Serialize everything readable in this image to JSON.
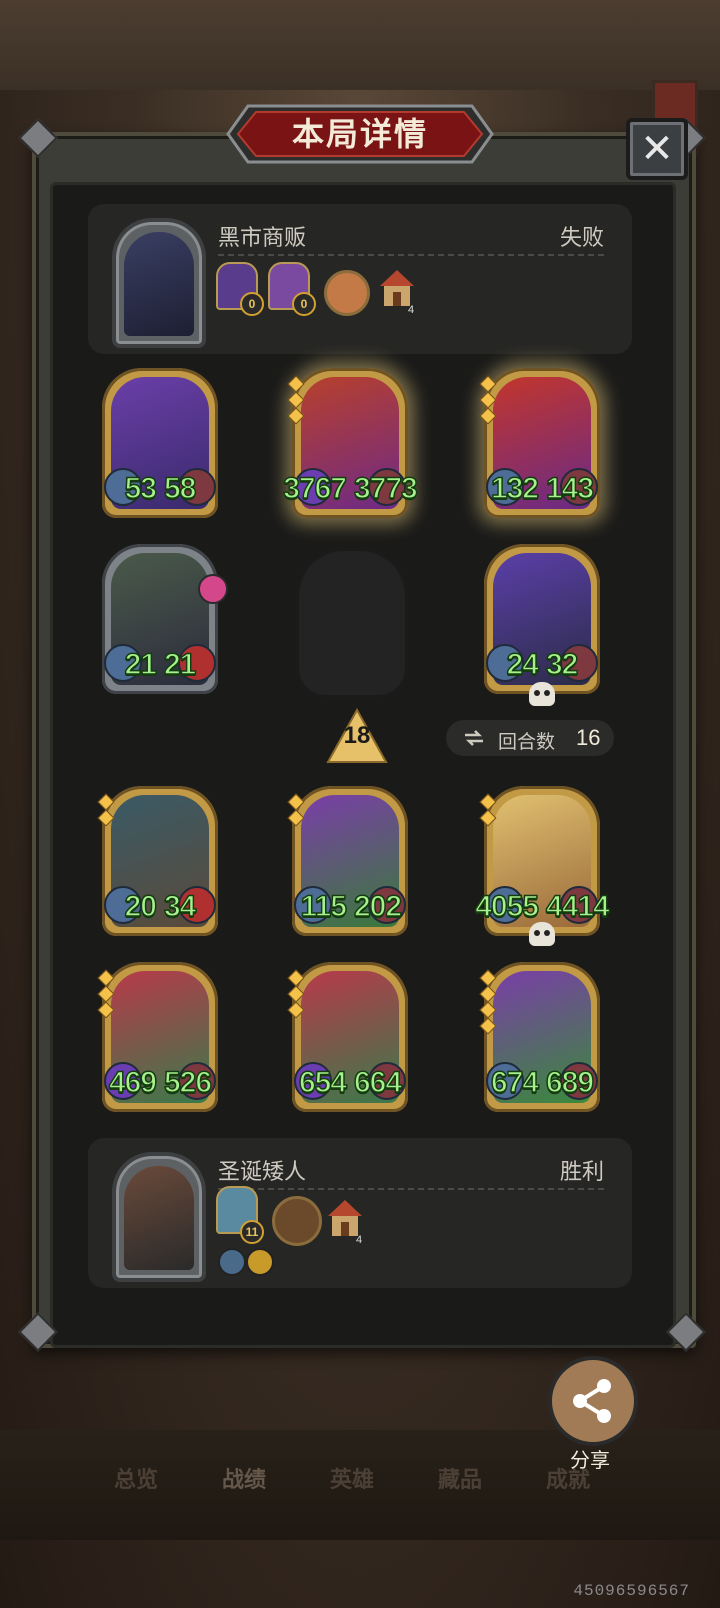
{
  "title": "本局详情",
  "close_label": "✕",
  "opponent": {
    "name": "黑市商贩",
    "result": "失败",
    "mini_badges": [
      "0",
      "0"
    ],
    "house_level": "4"
  },
  "player": {
    "name": "圣诞矮人",
    "result": "胜利",
    "mini_badges": [
      "11"
    ],
    "house_level": "4"
  },
  "opponent_units": [
    {
      "atk": "53",
      "hp": "58"
    },
    {
      "atk": "3767",
      "hp": "3773"
    },
    {
      "atk": "132",
      "hp": "143"
    },
    {
      "atk": "21",
      "hp": "21"
    },
    {
      "atk": "24",
      "hp": "32"
    }
  ],
  "tier": "18",
  "turns": {
    "label": "回合数",
    "value": "16"
  },
  "player_units": [
    {
      "atk": "20",
      "hp": "34"
    },
    {
      "atk": "115",
      "hp": "202"
    },
    {
      "atk": "4055",
      "hp": "4414"
    },
    {
      "atk": "469",
      "hp": "526"
    },
    {
      "atk": "654",
      "hp": "664"
    },
    {
      "atk": "674",
      "hp": "689"
    }
  ],
  "share_label": "分享",
  "tabs": [
    "总览",
    "战绩",
    "英雄",
    "藏品",
    "成就"
  ],
  "active_tab": "战绩",
  "id_number": "45096596567"
}
